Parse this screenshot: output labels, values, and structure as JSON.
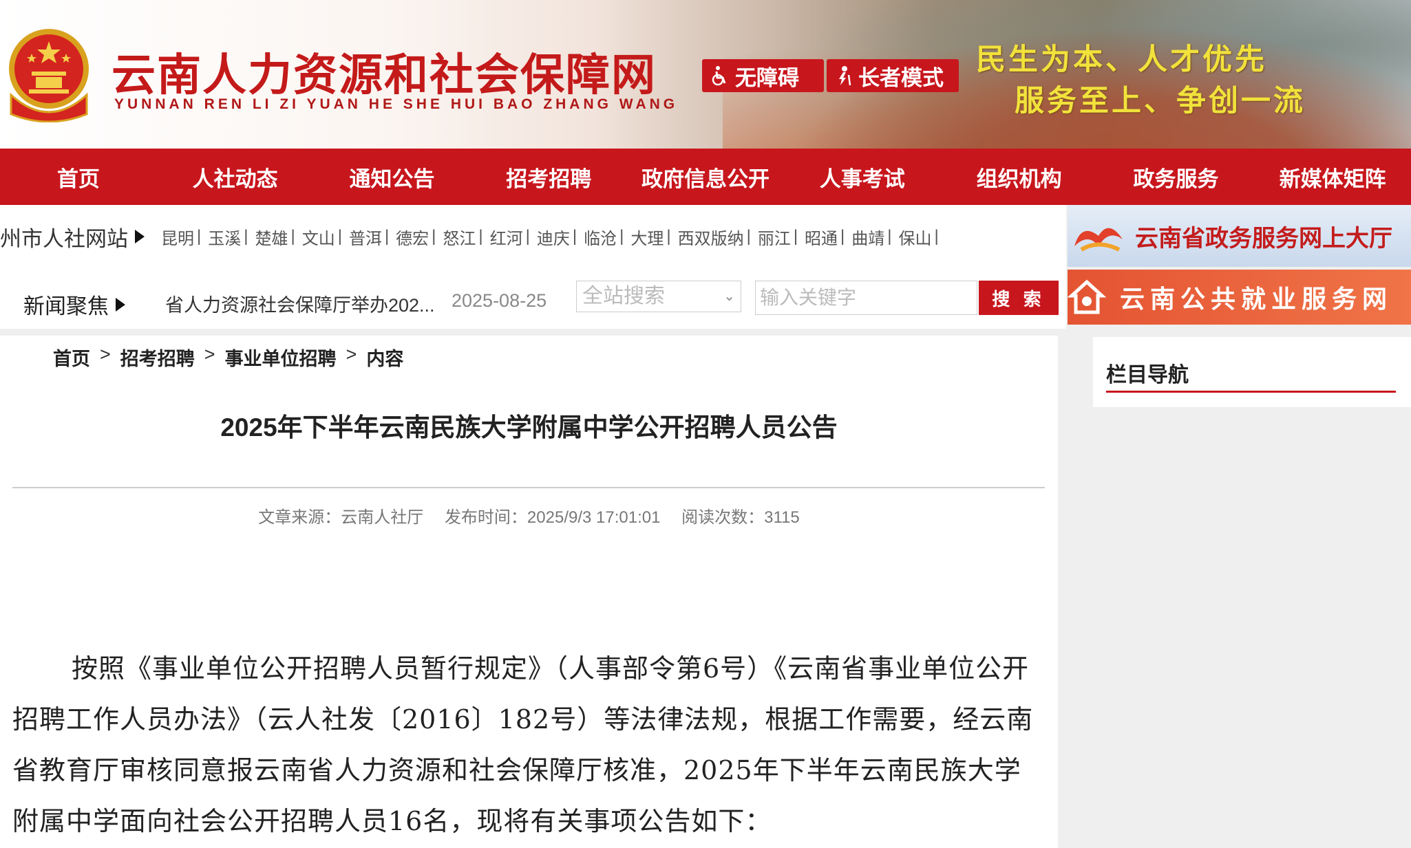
{
  "header": {
    "site_name_cn": "云南人力资源和社会保障网",
    "site_name_en": "YUNNAN REN LI ZI YUAN HE SHE HUI BAO ZHANG WANG",
    "accessibility_label": "无障碍",
    "elder_mode_label": "长者模式",
    "slogan_line1": "民生为本、人才优先",
    "slogan_line2": "服务至上、争创一流"
  },
  "nav": {
    "items": [
      "首页",
      "人社动态",
      "通知公告",
      "招考招聘",
      "政府信息公开",
      "人事考试",
      "组织机构",
      "政务服务",
      "新媒体矩阵"
    ]
  },
  "cities": {
    "title": "州市人社网站",
    "items": [
      "昆明",
      "玉溪",
      "楚雄",
      "文山",
      "普洱",
      "德宏",
      "怒江",
      "红河",
      "迪庆",
      "临沧",
      "大理",
      "西双版纳",
      "丽江",
      "昭通",
      "曲靖",
      "保山"
    ]
  },
  "news": {
    "title": "新闻聚焦",
    "headline": "省人力资源社会保障厅举办202...",
    "date": "2025-08-25"
  },
  "search": {
    "scope": "全站搜索",
    "placeholder": "输入关键字",
    "button": "搜 索"
  },
  "banners": {
    "gov_service": "云南省政务服务网上大厅",
    "employment": "云南公共就业服务网"
  },
  "breadcrumb": [
    "首页",
    "招考招聘",
    "事业单位招聘",
    "内容"
  ],
  "breadcrumb_sep": ">",
  "article": {
    "title": "2025年下半年云南民族大学附属中学公开招聘人员公告",
    "source": "文章来源：云南人社厅",
    "published": "发布时间：2025/9/3 17:01:01",
    "views": "阅读次数：3115",
    "body": "按照《事业单位公开招聘人员暂行规定》（人事部令第6号）《云南省事业单位公开招聘工作人员办法》（云人社发〔2016〕182号）等法律法规，根据工作需要，经云南省教育厅审核同意报云南省人力资源和社会保障厅核准，2025年下半年云南民族大学附属中学面向社会公开招聘人员16名，现将有关事项公告如下："
  },
  "sidebar": {
    "title": "栏目导航"
  },
  "colors": {
    "primary_red": "#c8161d",
    "slogan_yellow": "#f1e23c"
  }
}
